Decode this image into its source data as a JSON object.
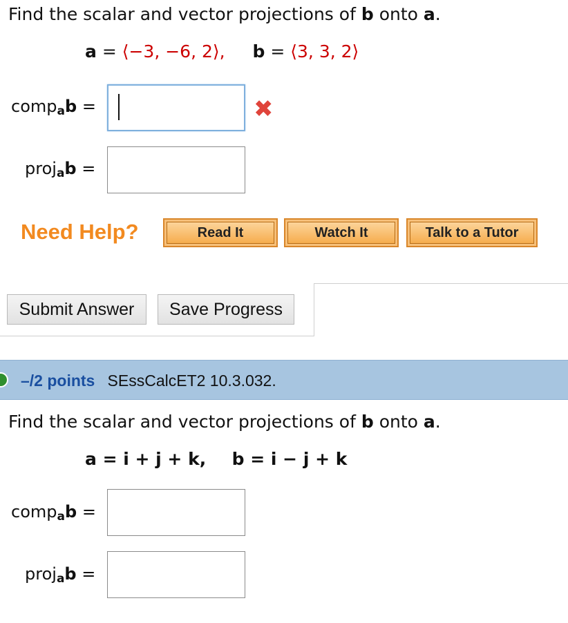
{
  "q1": {
    "prompt_prefix": "Find the scalar and vector projections of",
    "prompt_b": "b",
    "prompt_mid": "onto",
    "prompt_a": "a",
    "prompt_end": ".",
    "a_name": "a",
    "eq_sign": "=",
    "a_value": "⟨−3, −6, 2⟩,",
    "b_name": "b",
    "b_value": "⟨3, 3, 2⟩",
    "comp_label": "comp",
    "proj_label": "proj",
    "sub_a": "a",
    "vec_b": "b",
    "comp_value": "",
    "proj_value": "",
    "error_mark": "✖"
  },
  "help": {
    "title": "Need Help?",
    "read_it": "Read It",
    "watch_it": "Watch It",
    "talk_tutor": "Talk to a Tutor"
  },
  "actions": {
    "submit": "Submit Answer",
    "save": "Save Progress"
  },
  "q2_header": {
    "points": "–/2 points",
    "id": "SEssCalcET2 10.3.032."
  },
  "q2": {
    "prompt_prefix": "Find the scalar and vector projections of",
    "prompt_b": "b",
    "prompt_mid": "onto",
    "prompt_a": "a",
    "prompt_end": ".",
    "a_expr": "a = i + j + k,",
    "b_expr": "b = i − j + k",
    "comp_label": "comp",
    "proj_label": "proj",
    "sub_a": "a",
    "vec_b": "b",
    "comp_value": "",
    "proj_value": ""
  },
  "colors": {
    "accent_orange": "#f28a20",
    "value_red": "#cc0000",
    "header_blue": "#a7c5e0",
    "link_blue": "#1a4fa0"
  }
}
